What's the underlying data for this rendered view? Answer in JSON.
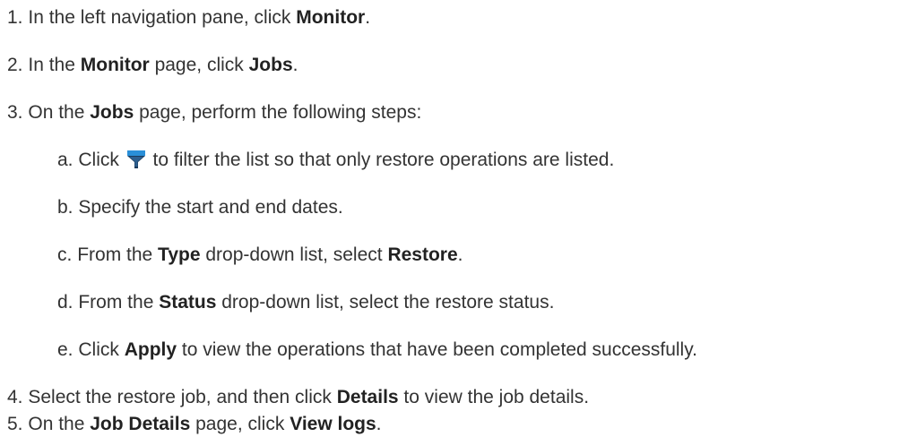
{
  "steps": [
    {
      "number": "1.",
      "pre": "In the left navigation pane, click ",
      "bold": "Monitor",
      "post": "."
    },
    {
      "number": "2.",
      "pre": "In the ",
      "bold1": "Monitor",
      "mid": " page, click ",
      "bold2": "Jobs",
      "post": "."
    },
    {
      "number": "3.",
      "pre": "On the ",
      "bold": "Jobs",
      "post": " page, perform the following steps:",
      "substeps": [
        {
          "letter": "a.",
          "pre": "Click ",
          "post": " to filter the list so that only restore operations are listed.",
          "icon": "filter-icon",
          "icon_colors": {
            "top": "#2a8fd8",
            "funnel": "#1a3a5c"
          }
        },
        {
          "letter": "b.",
          "text": "Specify the start and end dates."
        },
        {
          "letter": "c.",
          "pre": "From the ",
          "bold1": "Type",
          "mid": " drop-down list, select ",
          "bold2": "Restore",
          "post": "."
        },
        {
          "letter": "d.",
          "pre": "From the ",
          "bold": "Status",
          "post": " drop-down list, select the restore status."
        },
        {
          "letter": "e.",
          "pre": "Click ",
          "bold": "Apply",
          "post": " to view the operations that have been completed successfully."
        }
      ]
    },
    {
      "number": "4.",
      "pre": "Select the restore job, and then click ",
      "bold": "Details",
      "post": " to view the job details."
    },
    {
      "number": "5.",
      "pre": "On the ",
      "bold1": "Job Details",
      "mid": " page, click ",
      "bold2": "View logs",
      "post": "."
    }
  ]
}
